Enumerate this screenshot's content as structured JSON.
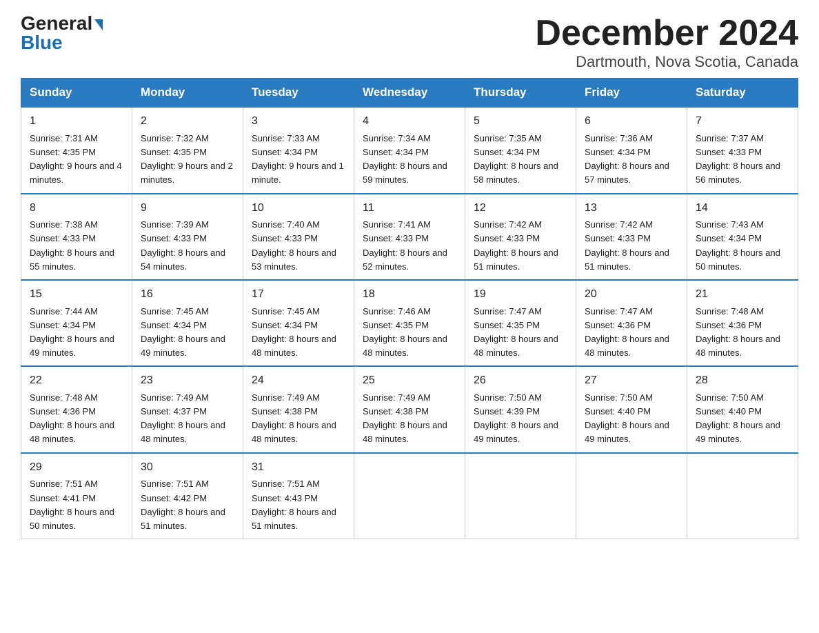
{
  "header": {
    "logo_line1": "General",
    "logo_line2": "Blue",
    "month": "December 2024",
    "location": "Dartmouth, Nova Scotia, Canada"
  },
  "days_of_week": [
    "Sunday",
    "Monday",
    "Tuesday",
    "Wednesday",
    "Thursday",
    "Friday",
    "Saturday"
  ],
  "weeks": [
    [
      {
        "day": "1",
        "sunrise": "7:31 AM",
        "sunset": "4:35 PM",
        "daylight": "9 hours and 4 minutes."
      },
      {
        "day": "2",
        "sunrise": "7:32 AM",
        "sunset": "4:35 PM",
        "daylight": "9 hours and 2 minutes."
      },
      {
        "day": "3",
        "sunrise": "7:33 AM",
        "sunset": "4:34 PM",
        "daylight": "9 hours and 1 minute."
      },
      {
        "day": "4",
        "sunrise": "7:34 AM",
        "sunset": "4:34 PM",
        "daylight": "8 hours and 59 minutes."
      },
      {
        "day": "5",
        "sunrise": "7:35 AM",
        "sunset": "4:34 PM",
        "daylight": "8 hours and 58 minutes."
      },
      {
        "day": "6",
        "sunrise": "7:36 AM",
        "sunset": "4:34 PM",
        "daylight": "8 hours and 57 minutes."
      },
      {
        "day": "7",
        "sunrise": "7:37 AM",
        "sunset": "4:33 PM",
        "daylight": "8 hours and 56 minutes."
      }
    ],
    [
      {
        "day": "8",
        "sunrise": "7:38 AM",
        "sunset": "4:33 PM",
        "daylight": "8 hours and 55 minutes."
      },
      {
        "day": "9",
        "sunrise": "7:39 AM",
        "sunset": "4:33 PM",
        "daylight": "8 hours and 54 minutes."
      },
      {
        "day": "10",
        "sunrise": "7:40 AM",
        "sunset": "4:33 PM",
        "daylight": "8 hours and 53 minutes."
      },
      {
        "day": "11",
        "sunrise": "7:41 AM",
        "sunset": "4:33 PM",
        "daylight": "8 hours and 52 minutes."
      },
      {
        "day": "12",
        "sunrise": "7:42 AM",
        "sunset": "4:33 PM",
        "daylight": "8 hours and 51 minutes."
      },
      {
        "day": "13",
        "sunrise": "7:42 AM",
        "sunset": "4:33 PM",
        "daylight": "8 hours and 51 minutes."
      },
      {
        "day": "14",
        "sunrise": "7:43 AM",
        "sunset": "4:34 PM",
        "daylight": "8 hours and 50 minutes."
      }
    ],
    [
      {
        "day": "15",
        "sunrise": "7:44 AM",
        "sunset": "4:34 PM",
        "daylight": "8 hours and 49 minutes."
      },
      {
        "day": "16",
        "sunrise": "7:45 AM",
        "sunset": "4:34 PM",
        "daylight": "8 hours and 49 minutes."
      },
      {
        "day": "17",
        "sunrise": "7:45 AM",
        "sunset": "4:34 PM",
        "daylight": "8 hours and 48 minutes."
      },
      {
        "day": "18",
        "sunrise": "7:46 AM",
        "sunset": "4:35 PM",
        "daylight": "8 hours and 48 minutes."
      },
      {
        "day": "19",
        "sunrise": "7:47 AM",
        "sunset": "4:35 PM",
        "daylight": "8 hours and 48 minutes."
      },
      {
        "day": "20",
        "sunrise": "7:47 AM",
        "sunset": "4:36 PM",
        "daylight": "8 hours and 48 minutes."
      },
      {
        "day": "21",
        "sunrise": "7:48 AM",
        "sunset": "4:36 PM",
        "daylight": "8 hours and 48 minutes."
      }
    ],
    [
      {
        "day": "22",
        "sunrise": "7:48 AM",
        "sunset": "4:36 PM",
        "daylight": "8 hours and 48 minutes."
      },
      {
        "day": "23",
        "sunrise": "7:49 AM",
        "sunset": "4:37 PM",
        "daylight": "8 hours and 48 minutes."
      },
      {
        "day": "24",
        "sunrise": "7:49 AM",
        "sunset": "4:38 PM",
        "daylight": "8 hours and 48 minutes."
      },
      {
        "day": "25",
        "sunrise": "7:49 AM",
        "sunset": "4:38 PM",
        "daylight": "8 hours and 48 minutes."
      },
      {
        "day": "26",
        "sunrise": "7:50 AM",
        "sunset": "4:39 PM",
        "daylight": "8 hours and 49 minutes."
      },
      {
        "day": "27",
        "sunrise": "7:50 AM",
        "sunset": "4:40 PM",
        "daylight": "8 hours and 49 minutes."
      },
      {
        "day": "28",
        "sunrise": "7:50 AM",
        "sunset": "4:40 PM",
        "daylight": "8 hours and 49 minutes."
      }
    ],
    [
      {
        "day": "29",
        "sunrise": "7:51 AM",
        "sunset": "4:41 PM",
        "daylight": "8 hours and 50 minutes."
      },
      {
        "day": "30",
        "sunrise": "7:51 AM",
        "sunset": "4:42 PM",
        "daylight": "8 hours and 51 minutes."
      },
      {
        "day": "31",
        "sunrise": "7:51 AM",
        "sunset": "4:43 PM",
        "daylight": "8 hours and 51 minutes."
      },
      null,
      null,
      null,
      null
    ]
  ]
}
